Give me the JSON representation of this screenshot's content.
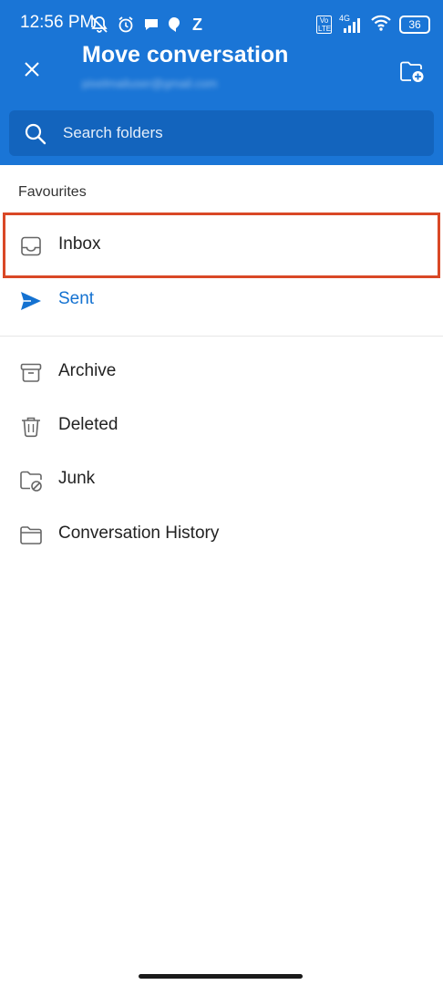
{
  "status_bar": {
    "time": "12:56 PM",
    "network": "4G",
    "battery": "36",
    "extra": "Z"
  },
  "header": {
    "title": "Move conversation",
    "account": "pixelmailuser@gmail.com",
    "background": "#1a75d6"
  },
  "search": {
    "placeholder": "Search folders"
  },
  "favourites": {
    "label": "Favourites",
    "items": [
      {
        "label": "Inbox",
        "icon": "inbox-icon"
      },
      {
        "label": "Sent",
        "icon": "send-icon",
        "color": "#1472d1"
      }
    ]
  },
  "folders": [
    {
      "label": "Archive",
      "icon": "archive-icon"
    },
    {
      "label": "Deleted",
      "icon": "trash-icon"
    },
    {
      "label": "Junk",
      "icon": "junk-folder-icon"
    },
    {
      "label": "Conversation History",
      "icon": "folder-icon"
    }
  ],
  "highlight_color": "#d94826"
}
